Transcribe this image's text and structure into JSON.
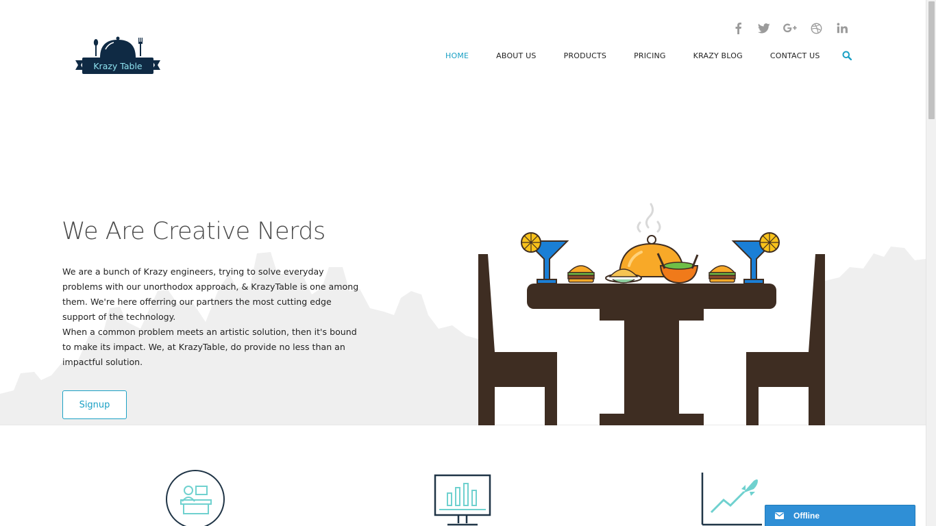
{
  "brand": {
    "logo_text": "Krazy Table"
  },
  "social": [
    {
      "name": "facebook-icon"
    },
    {
      "name": "twitter-icon"
    },
    {
      "name": "google-plus-icon"
    },
    {
      "name": "dribbble-icon"
    },
    {
      "name": "linkedin-icon"
    }
  ],
  "nav": {
    "items": [
      {
        "label": "HOME",
        "active": true
      },
      {
        "label": "ABOUT US"
      },
      {
        "label": "PRODUCTS"
      },
      {
        "label": "PRICING"
      },
      {
        "label": "KRAZY BLOG"
      },
      {
        "label": "CONTACT US"
      }
    ],
    "search_icon": "search-icon"
  },
  "hero": {
    "title": "We Are Creative Nerds",
    "paragraph1": "We are a bunch of Krazy engineers, trying to solve everyday problems with our unorthodox approach, & KrazyTable is one among them. We're here offerring our partners the most cutting edge support of the technology.",
    "paragraph2": "When a common problem meets an artistic solution, then it's bound to make its impact. We, at KrazyTable, do provide no less than an impactful solution.",
    "signup_label": "Signup"
  },
  "features": [
    {
      "icon": "desk-icon"
    },
    {
      "icon": "monitor-chart-icon"
    },
    {
      "icon": "growth-rocket-icon"
    }
  ],
  "chat": {
    "status": "Offline",
    "icon": "mail-icon"
  },
  "colors": {
    "accent": "#1aa0c4",
    "dark_brown": "#3e2d22",
    "chat_blue": "#2f8fd6",
    "logo_navy": "#0f2a44",
    "skyline": "#efefef"
  }
}
